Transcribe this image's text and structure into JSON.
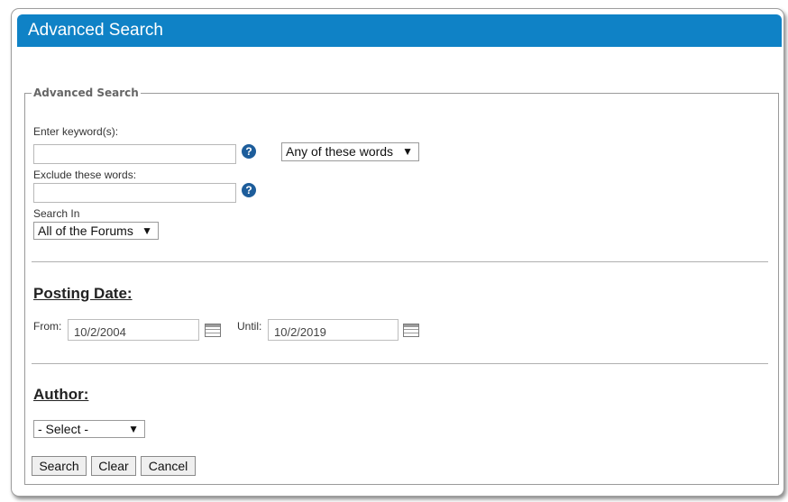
{
  "window": {
    "title": "Advanced Search"
  },
  "fieldset": {
    "legend": "Advanced Search"
  },
  "keywords": {
    "label": "Enter keyword(s):",
    "value": "",
    "help_icon": "question-circle-icon",
    "match_select": "Any of these words",
    "arrow": "▼"
  },
  "exclude": {
    "label": "Exclude these words:",
    "value": "",
    "help_icon": "question-circle-icon"
  },
  "search_in": {
    "label": "Search In",
    "selected": "All of the Forums",
    "arrow": "▼"
  },
  "posting_date": {
    "heading": "Posting Date:",
    "from_label": "From:",
    "from_value": "10/2/2004",
    "until_label": "Until:",
    "until_value": "10/2/2019",
    "calendar_icon": "calendar-icon"
  },
  "author": {
    "heading": "Author:",
    "selected": "- Select -",
    "arrow": "▼"
  },
  "buttons": {
    "search": "Search",
    "clear": "Clear",
    "cancel": "Cancel"
  },
  "colors": {
    "title_bar": "#0f82c6",
    "help_icon": "#1d5d9b"
  }
}
